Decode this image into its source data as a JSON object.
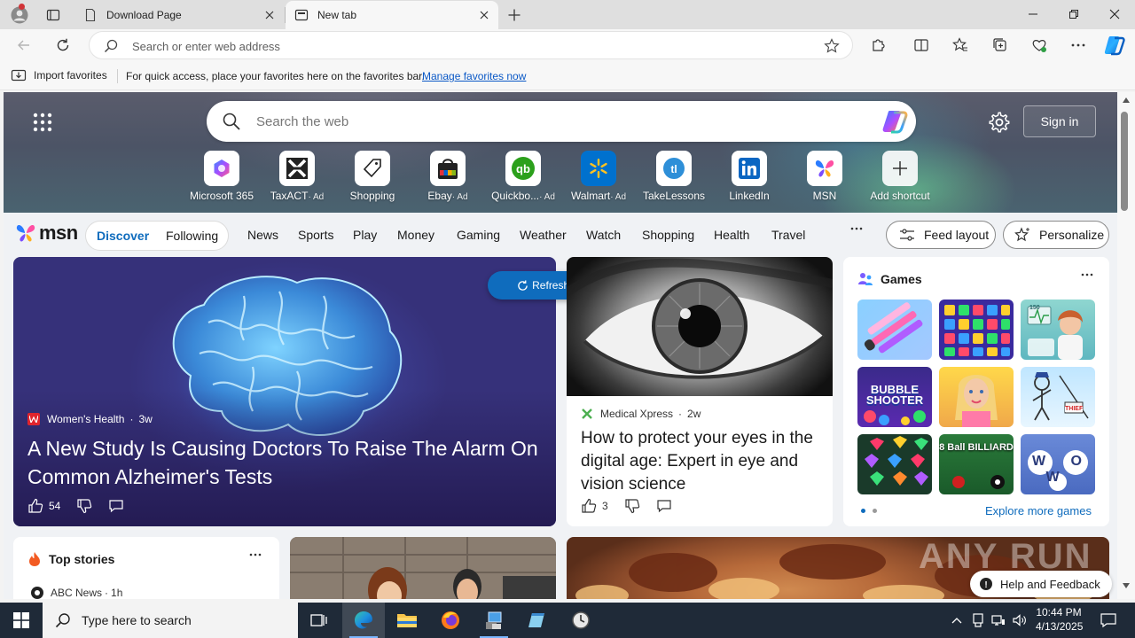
{
  "browser": {
    "tabs": [
      {
        "title": "Download Page",
        "active": false
      },
      {
        "title": "New tab",
        "active": true
      }
    ],
    "address_placeholder": "Search or enter web address"
  },
  "favorites_bar": {
    "import_label": "Import favorites",
    "message": "For quick access, place your favorites here on the favorites bar.",
    "manage_link": "Manage favorites now"
  },
  "newtab": {
    "search_placeholder": "Search the web",
    "sign_in": "Sign in",
    "quick_links": [
      {
        "label": "Microsoft 365",
        "ad": false
      },
      {
        "label": "TaxACT",
        "ad": true
      },
      {
        "label": "Shopping",
        "ad": false
      },
      {
        "label": "Ebay",
        "ad": true
      },
      {
        "label": "Quickbo...",
        "ad": true
      },
      {
        "label": "Walmart",
        "ad": true
      },
      {
        "label": "TakeLessons",
        "ad": false
      },
      {
        "label": "LinkedIn",
        "ad": false
      },
      {
        "label": "MSN",
        "ad": false
      },
      {
        "label": "Add shortcut",
        "ad": false
      }
    ],
    "ad_suffix": "· Ad"
  },
  "msn": {
    "logo_text": "msn",
    "pills": {
      "discover": "Discover",
      "following": "Following"
    },
    "nav": [
      "News",
      "Sports",
      "Play",
      "Money",
      "Gaming",
      "Weather",
      "Watch",
      "Shopping",
      "Health",
      "Travel"
    ],
    "more_icon": "ellipsis-icon",
    "feed_layout": "Feed layout",
    "personalize": "Personalize"
  },
  "hero": {
    "source": "Women's Health",
    "age": "3w",
    "title": "A New Study Is Causing Doctors To Raise The Alarm On Common Alzheimer's Tests",
    "likes": "54"
  },
  "refresh_button": "Refresh stories",
  "eye_story": {
    "source": "Medical Xpress",
    "age": "2w",
    "title": "How to protect your eyes in the digital age: Expert in eye and vision science",
    "likes": "3"
  },
  "games": {
    "title": "Games",
    "explore": "Explore more games",
    "tiles": [
      {
        "label": ""
      },
      {
        "label": ""
      },
      {
        "label": "150"
      },
      {
        "label": "BUBBLE SHOOTER"
      },
      {
        "label": ""
      },
      {
        "label": "THIEF"
      },
      {
        "label": ""
      },
      {
        "label": "8 Ball BILLIARD"
      },
      {
        "label": "W O W"
      }
    ]
  },
  "top_stories": {
    "title": "Top stories",
    "source": "ABC News",
    "age": "1h"
  },
  "watermark": "ANY RUN",
  "help_feedback": "Help and Feedback",
  "taskbar": {
    "search_placeholder": "Type here to search",
    "time": "10:44 PM",
    "date": "4/13/2025"
  },
  "colors": {
    "accent": "#0f6cbd",
    "taskbar": "#1f2a38",
    "link": "#0a58c6"
  }
}
